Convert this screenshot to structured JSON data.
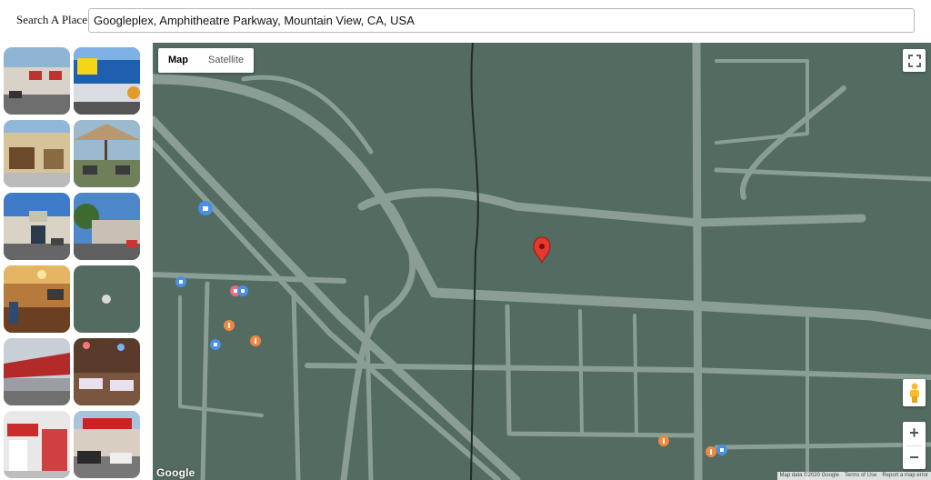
{
  "search": {
    "label": "Search A Place",
    "value": "Googleplex, Amphitheatre Parkway, Mountain View, CA, USA"
  },
  "photos": [
    {
      "name": "photo-shopping-center"
    },
    {
      "name": "photo-best-buy"
    },
    {
      "name": "photo-store-front"
    },
    {
      "name": "photo-patio-umbrella"
    },
    {
      "name": "photo-video-only"
    },
    {
      "name": "photo-shop-front"
    },
    {
      "name": "photo-restaurant-interior"
    },
    {
      "name": "photo-empty-placeholder"
    },
    {
      "name": "photo-warehouse"
    },
    {
      "name": "photo-dining-room"
    },
    {
      "name": "photo-store-aisle"
    },
    {
      "name": "photo-parking-lot"
    }
  ],
  "map": {
    "type_map_label": "Map",
    "type_satellite_label": "Satellite",
    "logo": "Google",
    "zoom_in_label": "+",
    "zoom_out_label": "−",
    "attribution": {
      "data": "Map data ©2020 Google",
      "terms": "Terms of Use",
      "report": "Report a map error"
    },
    "colors": {
      "background": "#536b60",
      "road": "#8a9e95",
      "pin": "#e8372c",
      "poi_food": "#f0883f",
      "poi_shop": "#4a8fe7",
      "poi_pink": "#e96c80"
    }
  }
}
